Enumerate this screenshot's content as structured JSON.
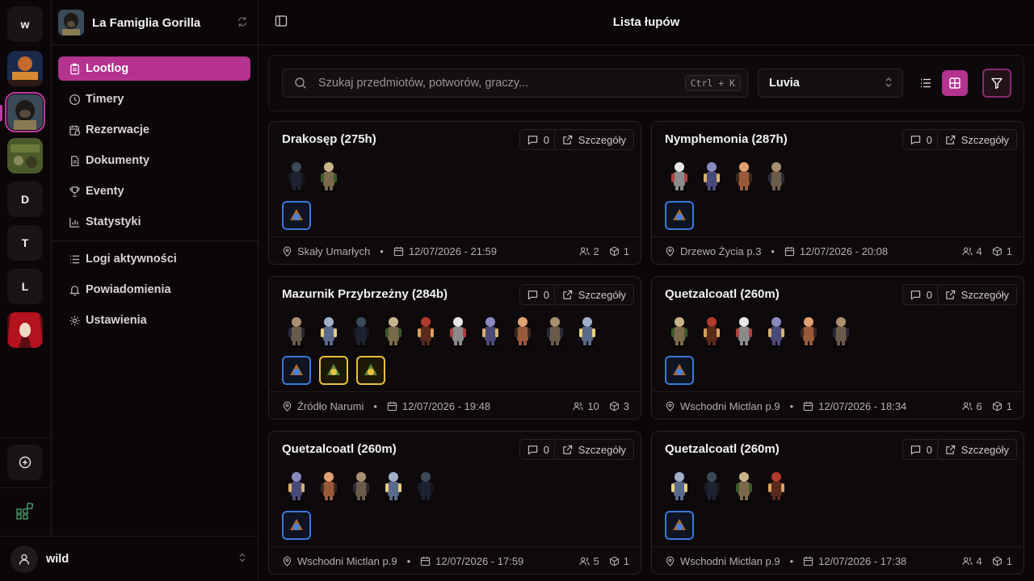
{
  "rail": {
    "servers": [
      {
        "label": "w"
      },
      {
        "label": ""
      },
      {
        "label": ""
      },
      {
        "label": ""
      },
      {
        "label": "D"
      },
      {
        "label": "T"
      },
      {
        "label": "L"
      },
      {
        "label": ""
      }
    ]
  },
  "sidebar": {
    "guild_name": "La Famiglia Gorilla",
    "nav": [
      {
        "label": "Lootlog",
        "icon": "clipboard-icon",
        "active": true
      },
      {
        "label": "Timery",
        "icon": "clock-icon"
      },
      {
        "label": "Rezerwacje",
        "icon": "calendar-clock-icon"
      },
      {
        "label": "Dokumenty",
        "icon": "document-icon"
      },
      {
        "label": "Eventy",
        "icon": "trophy-icon"
      },
      {
        "label": "Statystyki",
        "icon": "chart-icon"
      }
    ],
    "nav2": [
      {
        "label": "Logi aktywności",
        "icon": "list-icon"
      },
      {
        "label": "Powiadomienia",
        "icon": "bell-icon"
      },
      {
        "label": "Ustawienia",
        "icon": "gear-icon"
      }
    ]
  },
  "user": {
    "name": "wild"
  },
  "header": {
    "title": "Lista łupów"
  },
  "filters": {
    "search_placeholder": "Szukaj przedmiotów, potworów, graczy...",
    "shortcut": "Ctrl + K",
    "world": "Luvia"
  },
  "colors": {
    "accent": "#b3338f",
    "item_blue": "#3b78d8",
    "item_gold": "#e8c040"
  },
  "cards": [
    {
      "title": "Drakosęp (275h)",
      "comments": "0",
      "details": "Szczegóły",
      "location": "Skały Umarłych",
      "datetime": "12/07/2026 - 21:59",
      "players": "2",
      "items": "1",
      "mob_count": 2,
      "item_kinds": [
        "blue"
      ]
    },
    {
      "title": "Nymphemonia (287h)",
      "comments": "0",
      "details": "Szczegóły",
      "location": "Drzewo Życia p.3",
      "datetime": "12/07/2026 - 20:08",
      "players": "4",
      "items": "1",
      "mob_count": 4,
      "item_kinds": [
        "blue"
      ]
    },
    {
      "title": "Mazurnik Przybrzeżny (284b)",
      "comments": "0",
      "details": "Szczegóły",
      "location": "Źródło Narumi",
      "datetime": "12/07/2026 - 19:48",
      "players": "10",
      "items": "3",
      "mob_count": 10,
      "item_kinds": [
        "blue",
        "gold",
        "gold"
      ]
    },
    {
      "title": "Quetzalcoatl (260m)",
      "comments": "0",
      "details": "Szczegóły",
      "location": "Wschodni Mictlan p.9",
      "datetime": "12/07/2026 - 18:34",
      "players": "6",
      "items": "1",
      "mob_count": 6,
      "item_kinds": [
        "blue"
      ]
    },
    {
      "title": "Quetzalcoatl (260m)",
      "comments": "0",
      "details": "Szczegóły",
      "location": "Wschodni Mictlan p.9",
      "datetime": "12/07/2026 - 17:59",
      "players": "5",
      "items": "1",
      "mob_count": 5,
      "item_kinds": [
        "blue"
      ]
    },
    {
      "title": "Quetzalcoatl (260m)",
      "comments": "0",
      "details": "Szczegóły",
      "location": "Wschodni Mictlan p.9",
      "datetime": "12/07/2026 - 17:38",
      "players": "4",
      "items": "1",
      "mob_count": 4,
      "item_kinds": [
        "blue"
      ]
    }
  ]
}
